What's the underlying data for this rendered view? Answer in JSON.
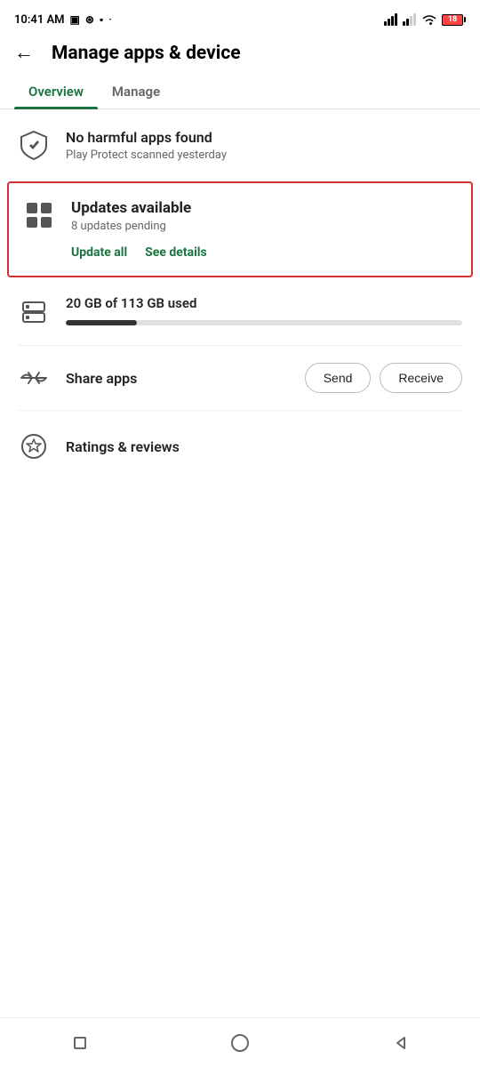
{
  "statusBar": {
    "time": "10:41 AM",
    "battery": "18"
  },
  "header": {
    "backLabel": "←",
    "title": "Manage apps & device"
  },
  "tabs": [
    {
      "id": "overview",
      "label": "Overview",
      "active": true
    },
    {
      "id": "manage",
      "label": "Manage",
      "active": false
    }
  ],
  "sections": {
    "playProtect": {
      "title": "No harmful apps found",
      "subtitle": "Play Protect scanned yesterday"
    },
    "updates": {
      "title": "Updates available",
      "subtitle": "8 updates pending",
      "updateAllLabel": "Update all",
      "seeDetailsLabel": "See details"
    },
    "storage": {
      "title": "20 GB of 113 GB used",
      "usedPercent": 18
    },
    "shareApps": {
      "title": "Share apps",
      "sendLabel": "Send",
      "receiveLabel": "Receive"
    },
    "ratingsReviews": {
      "title": "Ratings & reviews"
    }
  },
  "bottomNav": {
    "squareLabel": "■",
    "circleLabel": "○",
    "triangleLabel": "◁"
  }
}
